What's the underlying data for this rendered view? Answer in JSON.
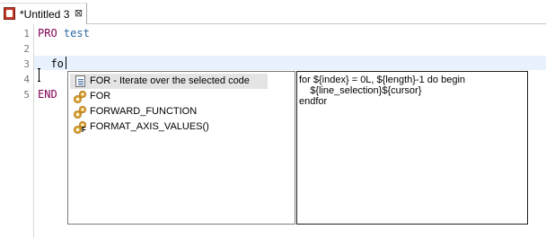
{
  "tab": {
    "title": "*Untitled 3",
    "close": "⊠"
  },
  "editor": {
    "lines": [
      {
        "no": "1",
        "kw": "PRO",
        "rest": "test"
      },
      {
        "no": "2",
        "text": ""
      },
      {
        "no": "3",
        "text": "  fo"
      },
      {
        "no": "4",
        "text": ""
      },
      {
        "no": "5",
        "kw": "END",
        "rest": ""
      }
    ]
  },
  "proposals": {
    "items": [
      {
        "label": "FOR - Iterate over the selected code",
        "icon": "template-icon"
      },
      {
        "label": "FOR",
        "icon": "gear-icon"
      },
      {
        "label": "FORWARD_FUNCTION",
        "icon": "gear-icon"
      },
      {
        "label": "FORMAT_AXIS_VALUES()",
        "icon": "gear-function-icon"
      }
    ]
  },
  "info": {
    "lines": [
      "for ${index} = 0L, ${length}-1 do begin",
      "    ${line_selection}${cursor}",
      "endfor"
    ]
  }
}
